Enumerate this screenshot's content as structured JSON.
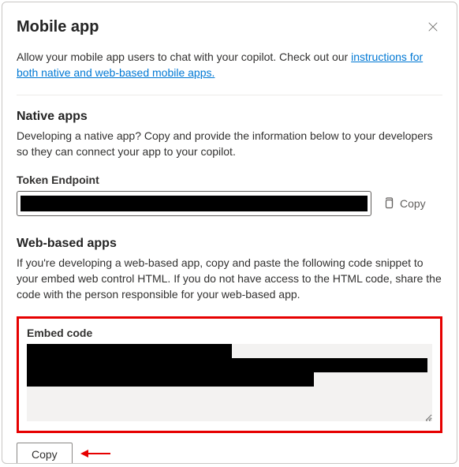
{
  "header": {
    "title": "Mobile app"
  },
  "intro": {
    "text_before_link": "Allow your mobile app users to chat with your copilot. Check out our ",
    "link_text": "instructions for both native and web-based mobile apps.",
    "text_after_link": ""
  },
  "native_section": {
    "title": "Native apps",
    "description": "Developing a native app? Copy and provide the information below to your developers so they can connect your app to your copilot.",
    "token_label": "Token Endpoint",
    "token_value": "[redacted]",
    "copy_label": "Copy"
  },
  "web_section": {
    "title": "Web-based apps",
    "description": "If you're developing a web-based app, copy and paste the following code snippet to your embed web control HTML. If you do not have access to the HTML code, share the code with the person responsible for your web-based app.",
    "embed_label": "Embed code",
    "embed_value": "[redacted]",
    "copy_button": "Copy"
  }
}
